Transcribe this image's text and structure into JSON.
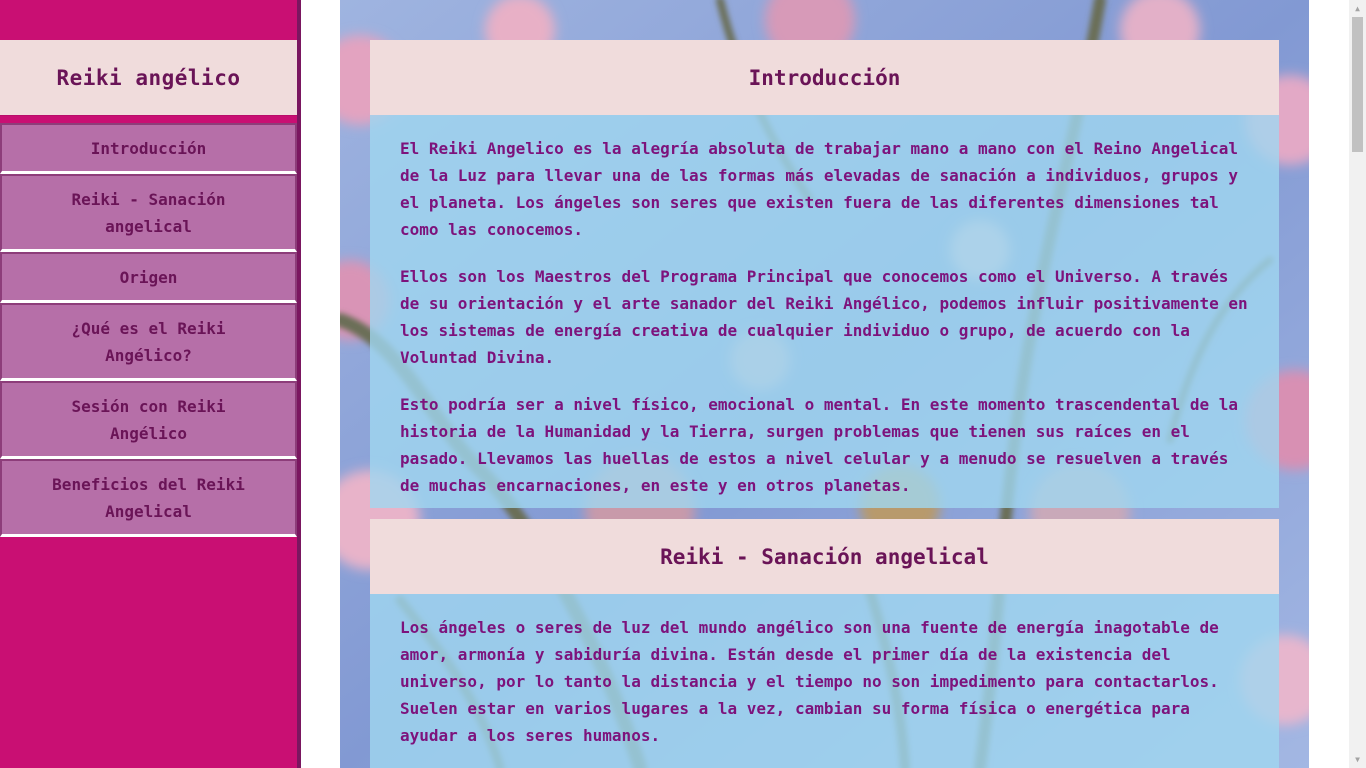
{
  "site_title": "Reiki angélico",
  "nav": {
    "items": [
      {
        "label": "Introducción"
      },
      {
        "label": "Reiki - Sanación angelical"
      },
      {
        "label": "Origen"
      },
      {
        "label": "¿Qué es el Reiki Angélico?"
      },
      {
        "label": "Sesión con Reiki Angélico"
      },
      {
        "label": "Beneficios del Reiki Angelical"
      }
    ]
  },
  "sections": [
    {
      "title": "Introducción",
      "paragraphs": [
        "El Reiki Angelico es la alegría absoluta de trabajar mano a mano con el Reino Angelical de la Luz para llevar una de las formas más elevadas de sanación a individuos, grupos y el planeta. Los ángeles son seres que existen fuera de las diferentes dimensiones tal como las conocemos.",
        "Ellos son los Maestros del Programa Principal que conocemos como el Universo. A través de su orientación y el arte sanador del Reiki Angélico, podemos influir positivamente en los sistemas de energía creativa de cualquier individuo o grupo, de acuerdo con la Voluntad Divina.",
        "Esto podría ser a nivel físico, emocional o mental. En este momento trascendental de la historia de la Humanidad y la Tierra, surgen problemas que tienen sus raíces en el pasado. Llevamos las huellas de estos a nivel celular y a menudo se resuelven a través de muchas encarnaciones, en este y en otros planetas."
      ]
    },
    {
      "title": "Reiki - Sanación angelical",
      "paragraphs": [
        "Los ángeles o seres de luz del mundo angélico son una fuente de energía inagotable de amor, armonía y sabiduría divina. Están desde el primer día de la existencia del universo, por lo tanto la distancia y el tiempo no son impedimento para contactarlos. Suelen estar en varios lugares a la vez, cambian su forma física o energética para ayudar a los seres humanos."
      ]
    }
  ],
  "colors": {
    "sidebar_bg": "#c90f73",
    "nav_item_bg": "#b66fa8",
    "heading_bg": "#f0dcdc",
    "heading_text": "#6a1457",
    "body_text": "#7d137c",
    "content_overlay": "#a0d7f0"
  },
  "background_image": "cherry-blossom-branches"
}
